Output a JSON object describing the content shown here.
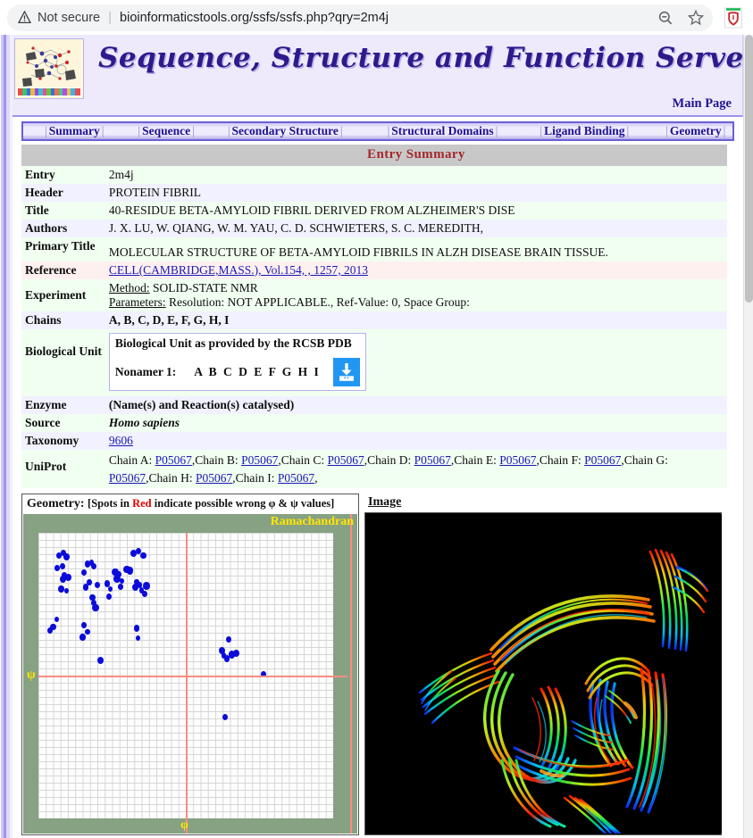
{
  "browser": {
    "security_label": "Not secure",
    "url": "bioinformaticstools.org/ssfs/ssfs.php?qry=2m4j",
    "divider": "|",
    "icons": {
      "warning": "warning-triangle-icon",
      "zoom_out": "zoom-out-icon",
      "bookmark": "star-icon",
      "extension": "shield-extension-icon"
    }
  },
  "header": {
    "site_title": "Sequence, Structure and Function Server",
    "main_page_link": "Main Page",
    "logo_alt": "molecule-thumbnail"
  },
  "nav": {
    "tabs": [
      {
        "label": "Summary"
      },
      {
        "label": "Sequence"
      },
      {
        "label": "Secondary Structure"
      },
      {
        "label": "Structural Domains"
      },
      {
        "label": "Ligand Binding"
      },
      {
        "label": "Geometry"
      }
    ]
  },
  "summary": {
    "heading": "Entry Summary",
    "rows": {
      "entry_label": "Entry",
      "entry_value": "2m4j",
      "header_label": "Header",
      "header_value": "PROTEIN FIBRIL",
      "title_label": "Title",
      "title_value": "40-RESIDUE BETA-AMYLOID FIBRIL DERIVED FROM ALZHEIMER'S DISE",
      "authors_label": "Authors",
      "authors_value": "J. X. LU, W. QIANG, W. M. YAU, C. D. SCHWIETERS, S. C. MEREDITH,",
      "primary_title_label": "Primary Title",
      "primary_title_value": "MOLECULAR STRUCTURE OF BETA-AMYLOID FIBRILS IN ALZH DISEASE BRAIN TISSUE.",
      "reference_label": "Reference",
      "reference_value": "CELL(CAMBRIDGE,MASS.), Vol.154, , 1257, 2013",
      "experiment_label": "Experiment",
      "experiment_method_label": "Method:",
      "experiment_method_value": "SOLID-STATE NMR",
      "experiment_params_label": "Parameters:",
      "experiment_params_value": "Resolution: NOT APPLICABLE., Ref-Value: 0, Space Group:",
      "chains_label": "Chains",
      "chains_value": "A, B, C, D, E, F, G, H, I",
      "biological_unit_label": "Biological Unit",
      "biological_unit_title": "Biological Unit as provided by the RCSB PDB",
      "biological_unit_entry_label": "Nonamer 1:",
      "biological_unit_chains": "A B C D E F G H I",
      "download_icon": "download-icon",
      "enzyme_label": "Enzyme",
      "enzyme_value": "(Name(s) and Reaction(s) catalysed)",
      "source_label": "Source",
      "source_value": "Homo sapiens",
      "taxonomy_label": "Taxonomy",
      "taxonomy_value": "9606",
      "uniprot_label": "UniProt",
      "uniprot_chains": [
        {
          "chain": "Chain A:",
          "acc": "P05067"
        },
        {
          "chain": "Chain B:",
          "acc": "P05067"
        },
        {
          "chain": "Chain C:",
          "acc": "P05067"
        },
        {
          "chain": "Chain D:",
          "acc": "P05067"
        },
        {
          "chain": "Chain E:",
          "acc": "P05067"
        },
        {
          "chain": "Chain F:",
          "acc": "P05067"
        },
        {
          "chain": "Chain G:",
          "acc": "P05067"
        },
        {
          "chain": "Chain H:",
          "acc": "P05067"
        },
        {
          "chain": "Chain I:",
          "acc": "P05067"
        }
      ]
    }
  },
  "panels": {
    "geometry": {
      "title_main": "Geometry:",
      "title_note_open": "[Spots in ",
      "title_note_red": "Red",
      "title_note_rest": " indicate possible wrong φ & ψ values]",
      "plot_label": "Ramachandran",
      "axis_y": "ψ",
      "axis_x": "φ"
    },
    "image": {
      "title": "Image",
      "alt": "protein-fibril-ribbon-render"
    }
  },
  "chart_data": {
    "type": "scatter",
    "title": "Ramachandran",
    "xlabel": "φ",
    "ylabel": "ψ",
    "xlim": [
      -180,
      180
    ],
    "ylim": [
      -180,
      180
    ],
    "grid": true,
    "point_color": "#0b0bdb",
    "axis_line_color": "#f98d82",
    "background": "#fdfdfd",
    "panel_background": "#87a183",
    "points": [
      {
        "phi": -155,
        "psi": 152
      },
      {
        "phi": -149,
        "psi": 155
      },
      {
        "phi": -146,
        "psi": 150
      },
      {
        "phi": -151,
        "psi": 139
      },
      {
        "phi": -157,
        "psi": 136
      },
      {
        "phi": -148,
        "psi": 127
      },
      {
        "phi": -150,
        "psi": 122
      },
      {
        "phi": -143,
        "psi": 124
      },
      {
        "phi": -152,
        "psi": 110
      },
      {
        "phi": -146,
        "psi": 108
      },
      {
        "phi": -120,
        "psi": 141
      },
      {
        "phi": -115,
        "psi": 143
      },
      {
        "phi": -112,
        "psi": 138
      },
      {
        "phi": -124,
        "psi": 131
      },
      {
        "phi": -118,
        "psi": 118
      },
      {
        "phi": -122,
        "psi": 112
      },
      {
        "phi": -108,
        "psi": 115
      },
      {
        "phi": -114,
        "psi": 99
      },
      {
        "phi": -112,
        "psi": 92
      },
      {
        "phi": -110,
        "psi": 86
      },
      {
        "phi": -96,
        "psi": 117
      },
      {
        "phi": -92,
        "psi": 110
      },
      {
        "phi": -94,
        "psi": 100
      },
      {
        "phi": -86,
        "psi": 131
      },
      {
        "phi": -82,
        "psi": 128
      },
      {
        "phi": -84,
        "psi": 123
      },
      {
        "phi": -78,
        "psi": 120
      },
      {
        "phi": -80,
        "psi": 113
      },
      {
        "phi": -72,
        "psi": 135
      },
      {
        "phi": -68,
        "psi": 133
      },
      {
        "phi": -64,
        "psi": 155
      },
      {
        "phi": -58,
        "psi": 158
      },
      {
        "phi": -52,
        "psi": 152
      },
      {
        "phi": -60,
        "psi": 119
      },
      {
        "phi": -56,
        "psi": 115
      },
      {
        "phi": -62,
        "psi": 112
      },
      {
        "phi": -54,
        "psi": 108
      },
      {
        "phi": -48,
        "psi": 114
      },
      {
        "phi": -50,
        "psi": 104
      },
      {
        "phi": -158,
        "psi": 72
      },
      {
        "phi": -162,
        "psi": 62
      },
      {
        "phi": -166,
        "psi": 58
      },
      {
        "phi": -124,
        "psi": 64
      },
      {
        "phi": -120,
        "psi": 56
      },
      {
        "phi": -126,
        "psi": 49
      },
      {
        "phi": -104,
        "psi": 20
      },
      {
        "phi": -60,
        "psi": 60
      },
      {
        "phi": -58,
        "psi": 48
      },
      {
        "phi": 52,
        "psi": 46
      },
      {
        "phi": 44,
        "psi": 32
      },
      {
        "phi": 46,
        "psi": 26
      },
      {
        "phi": 56,
        "psi": 27
      },
      {
        "phi": 50,
        "psi": 22
      },
      {
        "phi": 62,
        "psi": 29
      },
      {
        "phi": 95,
        "psi": 2
      },
      {
        "phi": 48,
        "psi": -52
      }
    ]
  }
}
